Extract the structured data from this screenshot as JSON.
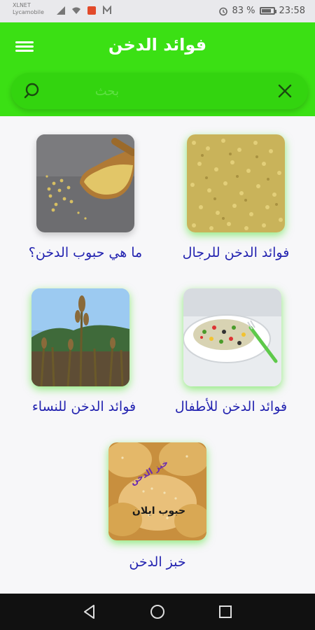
{
  "status": {
    "carrier_line1": "XLNET",
    "carrier_line2": "Lycamobile",
    "battery": "83 %",
    "battery_level": 0.83,
    "time": "23:58"
  },
  "appbar": {
    "title": "فوائد الدخن",
    "search_placeholder": "بحث"
  },
  "cards": [
    {
      "label": "فوائد الدخن للرجال"
    },
    {
      "label": "ما هي حبوب الدخن؟"
    },
    {
      "label": "فوائد الدخن للأطفال"
    },
    {
      "label": "فوائد الدخن للنساء"
    },
    {
      "label": "خبز الدخن",
      "overlay_top": "خبز الدخن",
      "overlay_main": "حبوب ايلان"
    }
  ],
  "colors": {
    "accent": "#3be014",
    "label": "#2323b0"
  }
}
